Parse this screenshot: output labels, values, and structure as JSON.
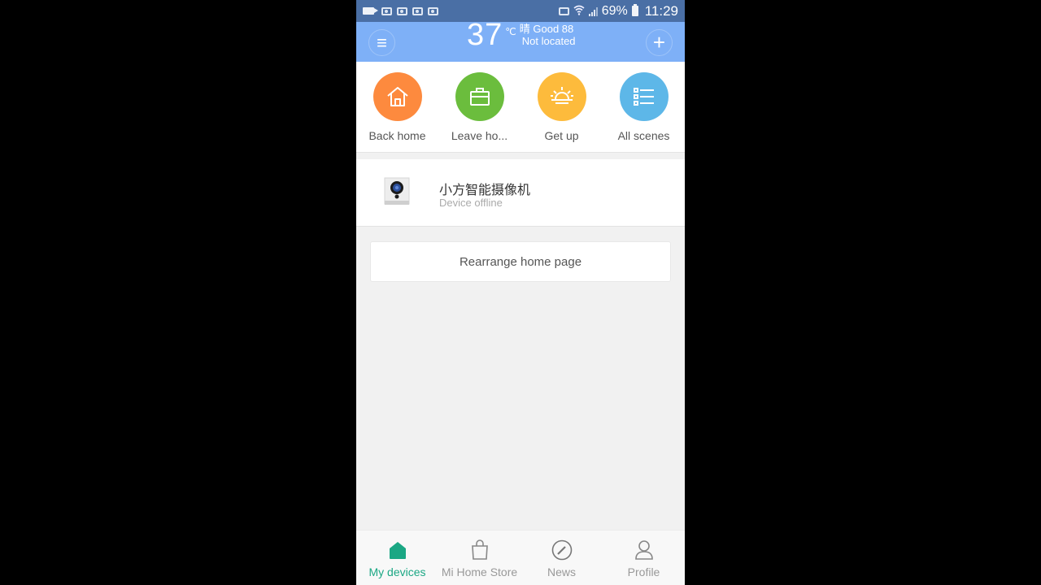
{
  "status_bar": {
    "battery": "69%",
    "time": "11:29"
  },
  "header": {
    "temperature": "37",
    "unit": "℃",
    "weather_line": "晴 Good 88",
    "location": "Not located",
    "menu_icon": "≡",
    "add_icon": "+"
  },
  "scenes": [
    {
      "label": "Back home",
      "icon": "house-icon",
      "color": "#fd8a3e"
    },
    {
      "label": "Leave ho...",
      "icon": "briefcase-icon",
      "color": "#6bbd3d"
    },
    {
      "label": "Get up",
      "icon": "sunrise-icon",
      "color": "#fdbb3c"
    },
    {
      "label": "All scenes",
      "icon": "list-icon",
      "color": "#5db7e8"
    }
  ],
  "devices": [
    {
      "name": "小方智能摄像机",
      "status": "Device offline",
      "icon": "camera-icon"
    }
  ],
  "rearrange_label": "Rearrange home page",
  "bottom_nav": [
    {
      "label": "My devices",
      "icon": "home-icon",
      "active": true
    },
    {
      "label": "Mi Home Store",
      "icon": "bag-icon",
      "active": false
    },
    {
      "label": "News",
      "icon": "compass-icon",
      "active": false
    },
    {
      "label": "Profile",
      "icon": "person-icon",
      "active": false
    }
  ],
  "colors": {
    "accent": "#1ba784",
    "header_bg": "#7eb0f7",
    "statusbar_bg": "#4a6fa5"
  }
}
